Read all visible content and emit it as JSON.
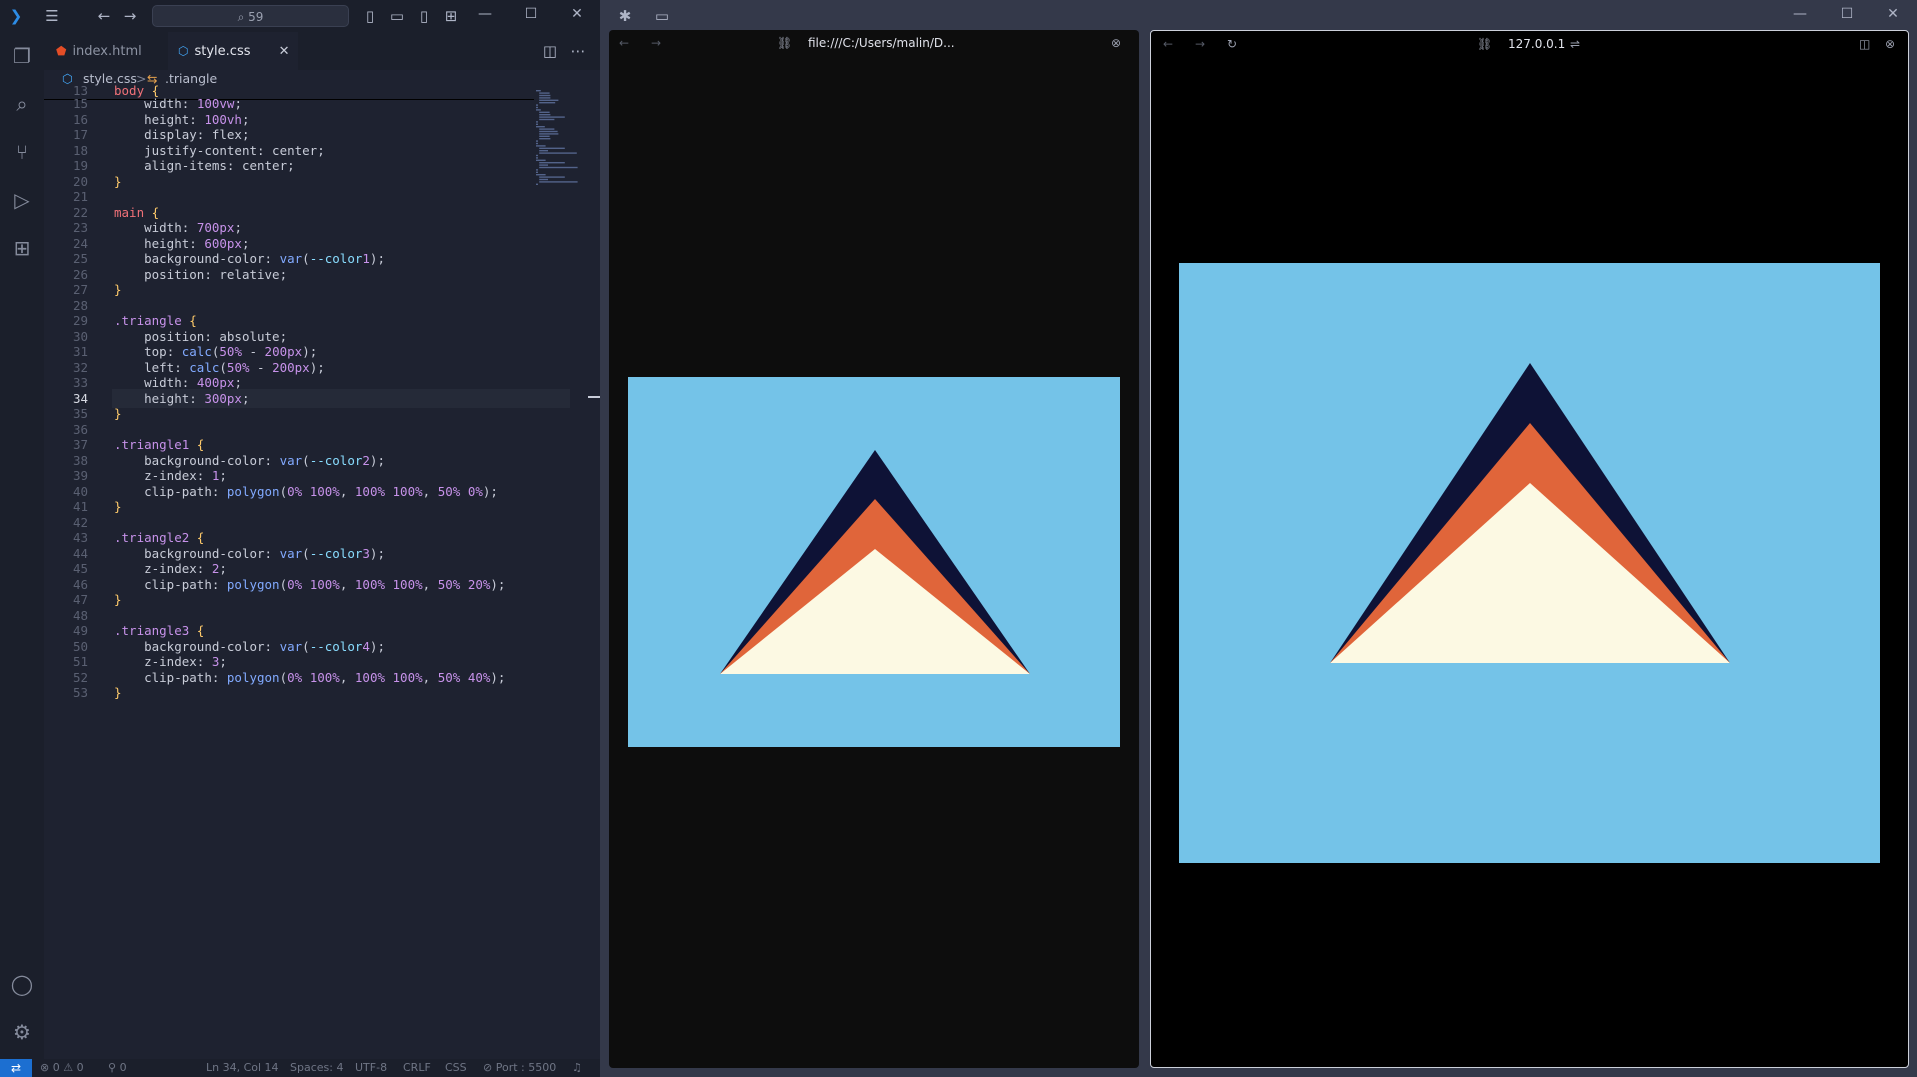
{
  "vscode": {
    "command_center": "59",
    "tabs": [
      {
        "label": "index.html",
        "icon": "html-file-icon"
      },
      {
        "label": "style.css",
        "icon": "css-file-icon",
        "close": "✕"
      }
    ],
    "breadcrumb": {
      "file": "style.css",
      "sep": ">",
      "symbol": ".triangle"
    },
    "code_lines": [
      {
        "n": "13",
        "text": "body {"
      },
      {
        "n": "15",
        "text": "    width: 100vw;"
      },
      {
        "n": "16",
        "text": "    height: 100vh;"
      },
      {
        "n": "17",
        "text": "    display: flex;"
      },
      {
        "n": "18",
        "text": "    justify-content: center;"
      },
      {
        "n": "19",
        "text": "    align-items: center;"
      },
      {
        "n": "20",
        "text": "}"
      },
      {
        "n": "21",
        "text": ""
      },
      {
        "n": "22",
        "text": "main {"
      },
      {
        "n": "23",
        "text": "    width: 700px;"
      },
      {
        "n": "24",
        "text": "    height: 600px;"
      },
      {
        "n": "25",
        "text": "    background-color: var(--color1);"
      },
      {
        "n": "26",
        "text": "    position: relative;"
      },
      {
        "n": "27",
        "text": "}"
      },
      {
        "n": "28",
        "text": ""
      },
      {
        "n": "29",
        "text": ".triangle {"
      },
      {
        "n": "30",
        "text": "    position: absolute;"
      },
      {
        "n": "31",
        "text": "    top: calc(50% - 200px);"
      },
      {
        "n": "32",
        "text": "    left: calc(50% - 200px);"
      },
      {
        "n": "33",
        "text": "    width: 400px;"
      },
      {
        "n": "34",
        "text": "    height: 300px;"
      },
      {
        "n": "35",
        "text": "}"
      },
      {
        "n": "36",
        "text": ""
      },
      {
        "n": "37",
        "text": ".triangle1 {"
      },
      {
        "n": "38",
        "text": "    background-color: var(--color2);"
      },
      {
        "n": "39",
        "text": "    z-index: 1;"
      },
      {
        "n": "40",
        "text": "    clip-path: polygon(0% 100%, 100% 100%, 50% 0%);"
      },
      {
        "n": "41",
        "text": "}"
      },
      {
        "n": "42",
        "text": ""
      },
      {
        "n": "43",
        "text": ".triangle2 {"
      },
      {
        "n": "44",
        "text": "    background-color: var(--color3);"
      },
      {
        "n": "45",
        "text": "    z-index: 2;"
      },
      {
        "n": "46",
        "text": "    clip-path: polygon(0% 100%, 100% 100%, 50% 20%);"
      },
      {
        "n": "47",
        "text": "}"
      },
      {
        "n": "48",
        "text": ""
      },
      {
        "n": "49",
        "text": ".triangle3 {"
      },
      {
        "n": "50",
        "text": "    background-color: var(--color4);"
      },
      {
        "n": "51",
        "text": "    z-index: 3;"
      },
      {
        "n": "52",
        "text": "    clip-path: polygon(0% 100%, 100% 100%, 50% 40%);"
      },
      {
        "n": "53",
        "text": "}"
      }
    ],
    "current_line": "34",
    "status": {
      "errors": "0",
      "warnings": "0",
      "ports": "0",
      "position": "Ln 34, Col 14",
      "spaces": "Spaces: 4",
      "encoding": "UTF-8",
      "eol": "CRLF",
      "language": "CSS",
      "port": "Port : 5500"
    }
  },
  "browser": {
    "left_pane": {
      "url": "file:///C:/Users/malin/D..."
    },
    "right_pane": {
      "url": "127.0.0.1"
    }
  },
  "colors": {
    "color1": "#74c3e8",
    "color2": "#0e1236",
    "color3": "#e0653a",
    "color4": "#fcf9e3"
  }
}
